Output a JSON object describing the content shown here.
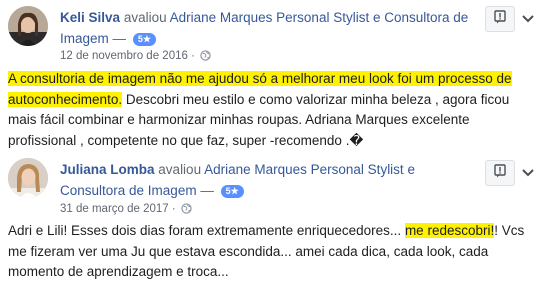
{
  "reviews": [
    {
      "author": "Keli Silva",
      "verb": "avaliou",
      "page": "Adriane Marques Personal Stylist e Consultora de Imagem",
      "dash": "—",
      "rating": "5★",
      "date": "12 de novembro de 2016",
      "dot": "·",
      "text_highlight": "A consultoria de imagem não me ajudou só a melhorar meu look foi um processo de autoconhecimento.",
      "text_rest": " Descobri meu estilo e como valorizar minha beleza , agora ficou mais fácil combinar e harmonizar minhas roupas. Adriana Marques excelente profissional , competente no que faz, super -recomendo .�"
    },
    {
      "author": "Juliana Lomba",
      "verb": "avaliou",
      "page": "Adriane Marques Personal Stylist e Consultora de Imagem",
      "dash": "—",
      "rating": "5★",
      "date": "31 de março de 2017",
      "dot": "·",
      "text_before": "Adri e Lili! Esses dois dias foram extremamente enriquecedores... ",
      "text_highlight": "me redescobri!",
      "text_after": "! Vcs me fizeram ver uma Ju que estava escondida... amei cada dica, cada look, cada momento de aprendizagem e troca..."
    }
  ],
  "icons": {
    "report": "report-flag-icon",
    "more": "chevron-down-icon",
    "privacy": "globe-icon"
  },
  "colors": {
    "link": "#365899",
    "badge": "#5890ff",
    "highlight": "#fff200",
    "meta": "#616770"
  }
}
